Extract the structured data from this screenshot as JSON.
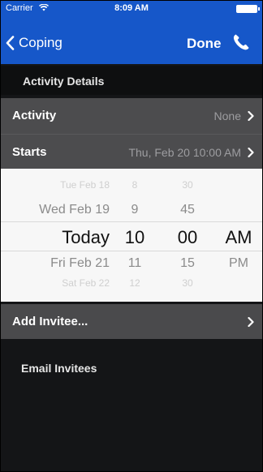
{
  "status": {
    "carrier": "Carrier",
    "time": "8:09 AM"
  },
  "nav": {
    "back_label": "Coping",
    "done_label": "Done"
  },
  "section": {
    "activity_details": "Activity Details",
    "email_invitees": "Email Invitees"
  },
  "rows": {
    "activity": {
      "label": "Activity",
      "value": "None"
    },
    "starts": {
      "label": "Starts",
      "value": "Thu, Feb 20 10:00 AM"
    },
    "invitee": {
      "label": "Add Invitee..."
    }
  },
  "picker": {
    "rows": [
      {
        "date": "Tue Feb 18",
        "hour": "8",
        "minute": "30",
        "ampm": ""
      },
      {
        "date": "Wed Feb 19",
        "hour": "9",
        "minute": "45",
        "ampm": ""
      },
      {
        "date": "Today",
        "hour": "10",
        "minute": "00",
        "ampm": "AM"
      },
      {
        "date": "Fri Feb 21",
        "hour": "11",
        "minute": "15",
        "ampm": "PM"
      },
      {
        "date": "Sat Feb 22",
        "hour": "12",
        "minute": "30",
        "ampm": ""
      }
    ]
  },
  "colors": {
    "nav_blue": "#1657c9",
    "row_gray": "#4c4c4e",
    "background": "#141517"
  },
  "icons": {
    "back": "chevron-left-icon",
    "phone": "phone-icon",
    "disclosure": "chevron-right-icon"
  }
}
